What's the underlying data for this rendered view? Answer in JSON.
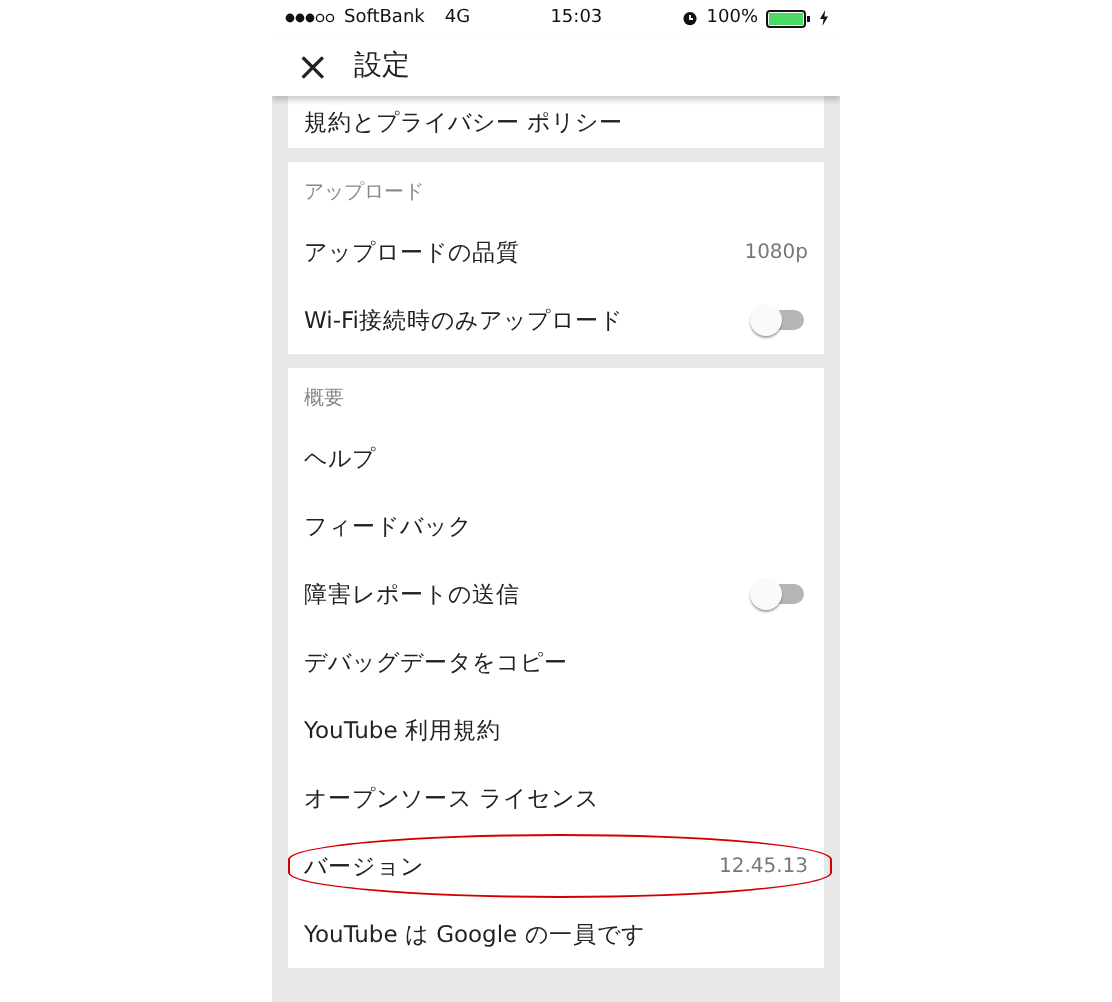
{
  "status_bar": {
    "carrier": "SoftBank",
    "network": "4G",
    "time": "15:03",
    "battery": "100%"
  },
  "header": {
    "close": "×",
    "title": "設定"
  },
  "sections": [
    {
      "rows": [
        {
          "kind": "link",
          "label": "規約とプライバシー ポリシー"
        }
      ]
    },
    {
      "title": "アップロード",
      "rows": [
        {
          "kind": "value",
          "label": "アップロードの品質",
          "value": "1080p"
        },
        {
          "kind": "toggle",
          "label": "Wi-Fi接続時のみアップロード",
          "on": false
        }
      ]
    },
    {
      "title": "概要",
      "rows": [
        {
          "kind": "link",
          "label": "ヘルプ"
        },
        {
          "kind": "link",
          "label": "フィードバック"
        },
        {
          "kind": "toggle",
          "label": "障害レポートの送信",
          "on": false
        },
        {
          "kind": "link",
          "label": "デバッグデータをコピー"
        },
        {
          "kind": "link",
          "label": "YouTube 利用規約"
        },
        {
          "kind": "link",
          "label": "オープンソース ライセンス"
        },
        {
          "kind": "value",
          "label": "バージョン",
          "value": "12.45.13",
          "highlighted": true
        },
        {
          "kind": "link",
          "label": "YouTube は Google の一員です"
        }
      ]
    }
  ]
}
